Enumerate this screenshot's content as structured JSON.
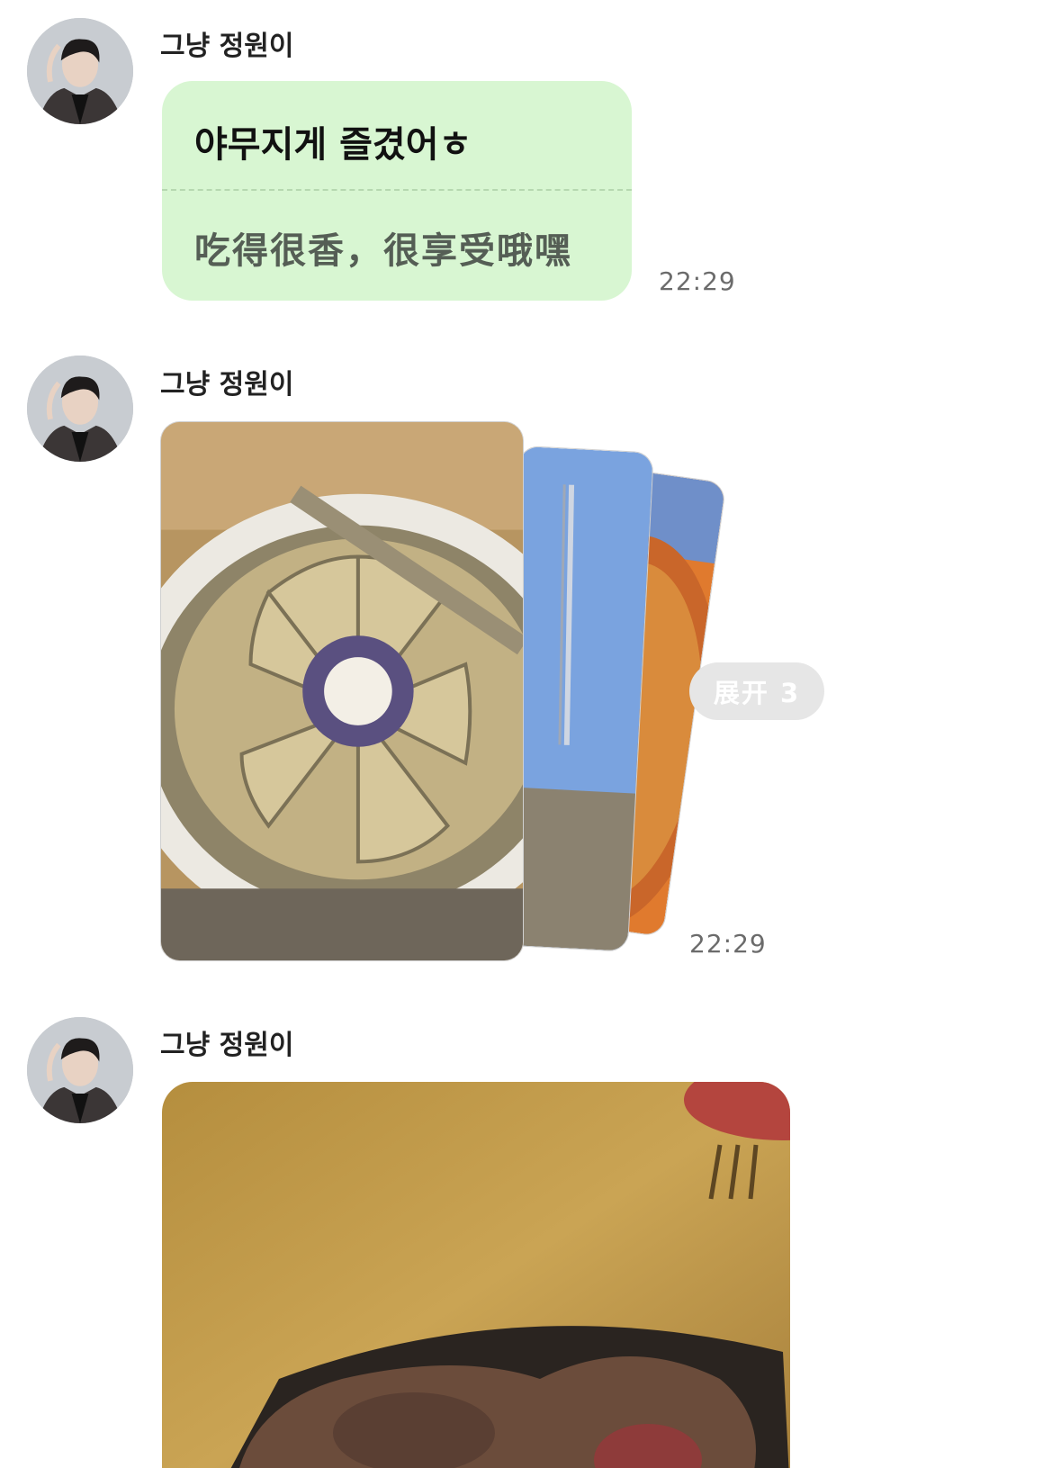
{
  "messages": [
    {
      "sender": "그냥 정원이",
      "text_original": "야무지게 즐겼어ㅎ",
      "text_translation": "吃得很香，很享受哦嘿",
      "time": "22:29"
    },
    {
      "sender": "그냥 정원이",
      "expand_label": "展开 3",
      "time": "22:29"
    },
    {
      "sender": "그냥 정원이"
    }
  ],
  "colors": {
    "bubble_bg": "#d8f6d2",
    "expand_bg": "#e6e6e6",
    "timestamp": "#6b6b6b"
  }
}
